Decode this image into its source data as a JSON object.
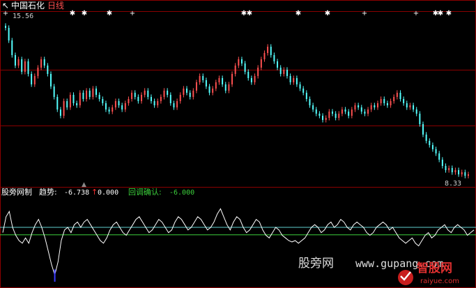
{
  "header": {
    "stock_name": "中国石化",
    "period": "日线",
    "high_label": "15.56",
    "low_label": "8.33"
  },
  "indicator": {
    "name": "股旁网制",
    "trend_label": "趋势:",
    "trend_value": "-6.738",
    "trend_arrow": "↑",
    "second_value": "0.000",
    "confirm_label": "回调确认:",
    "confirm_value": "-6.000"
  },
  "watermark": {
    "site_cn": "股旁网",
    "site_url": "www.gupang.com",
    "brand": "智股网",
    "brand_url": "raiyue.com"
  },
  "colors": {
    "background": "#000000",
    "frame": "#8b0000",
    "grid": "#8b0000",
    "up_candle": "#ff5050",
    "down_candle": "#54ffff",
    "indicator_line": "#ffffff",
    "upper_ref_line": "#5fd0d0",
    "lower_ref_line": "#3cd03c",
    "trend_text": "#ffffff",
    "confirm_text": "#3cd03c",
    "arrow": "#ff3030",
    "signal_blue": "#3a3aff",
    "marker": "#ffffff"
  },
  "chart_data": [
    {
      "type": "candlestick",
      "title": "中国石化 日线",
      "price_high": 15.56,
      "price_low": 8.33,
      "ylim": [
        8.0,
        16.0
      ],
      "grid": true,
      "closes": [
        15.4,
        14.8,
        14.1,
        13.6,
        13.9,
        13.3,
        13.8,
        13.2,
        12.7,
        13.1,
        13.5,
        13.9,
        13.6,
        13.2,
        12.6,
        12.1,
        11.5,
        11.2,
        11.9,
        11.6,
        12.2,
        11.8,
        11.7,
        12.3,
        12.0,
        12.4,
        12.1,
        12.5,
        12.2,
        12.0,
        11.8,
        11.5,
        11.4,
        11.6,
        11.9,
        11.7,
        11.5,
        11.8,
        12.0,
        12.3,
        12.1,
        11.9,
        12.2,
        12.4,
        12.1,
        11.9,
        11.7,
        11.9,
        12.1,
        12.4,
        12.2,
        11.8,
        11.6,
        11.9,
        12.2,
        12.5,
        12.3,
        12.1,
        12.4,
        12.8,
        13.1,
        12.9,
        12.6,
        12.3,
        12.5,
        12.8,
        13.0,
        12.7,
        12.4,
        12.7,
        13.2,
        13.6,
        13.9,
        13.7,
        13.3,
        13.0,
        12.8,
        13.1,
        13.5,
        13.9,
        14.2,
        14.5,
        14.1,
        13.8,
        13.5,
        13.2,
        13.4,
        13.1,
        12.8,
        13.0,
        12.7,
        12.5,
        12.3,
        12.0,
        11.7,
        11.5,
        11.3,
        11.2,
        11.0,
        11.1,
        11.4,
        11.3,
        11.1,
        11.3,
        11.5,
        11.4,
        11.2,
        11.5,
        11.7,
        11.6,
        11.4,
        11.3,
        11.5,
        11.7,
        11.6,
        11.8,
        12.0,
        11.8,
        11.7,
        11.9,
        12.1,
        12.3,
        12.0,
        11.8,
        11.6,
        11.7,
        11.5,
        11.3,
        10.8,
        10.3,
        10.0,
        9.8,
        9.6,
        9.4,
        9.1,
        8.8,
        8.6,
        8.7,
        8.5,
        8.6,
        8.4,
        8.5,
        8.33,
        8.4
      ]
    },
    {
      "type": "line",
      "title": "股旁网制",
      "series": [
        {
          "name": "趋势",
          "values": [
            -2,
            4,
            6,
            0,
            -3,
            -5,
            -6,
            -4,
            -6,
            -2,
            1,
            3,
            0,
            -4,
            -9,
            -14,
            -18,
            -13,
            -5,
            -1,
            0,
            -2,
            1,
            2,
            0,
            2,
            3,
            1,
            -1,
            -3,
            -5,
            -6,
            -4,
            -1,
            1,
            2,
            0,
            -2,
            -3,
            -1,
            1,
            3,
            4,
            2,
            0,
            -2,
            -1,
            1,
            3,
            2,
            0,
            -2,
            -1,
            2,
            4,
            3,
            1,
            -1,
            0,
            2,
            4,
            3,
            1,
            -1,
            0,
            2,
            5,
            7,
            4,
            1,
            -1,
            2,
            4,
            3,
            0,
            -2,
            -1,
            1,
            3,
            2,
            -1,
            -3,
            -4,
            -2,
            0,
            -1,
            -3,
            -4,
            -5,
            -5.5,
            -5,
            -6,
            -5,
            -4,
            -2,
            0,
            1,
            0,
            -2,
            -1,
            1,
            2,
            0,
            1,
            3,
            2,
            0,
            -1,
            1,
            2,
            1,
            0,
            -2,
            -3,
            -2,
            0,
            1,
            2,
            1,
            -1,
            0,
            -2,
            -4,
            -5,
            -6,
            -5,
            -4,
            -6,
            -7,
            -5,
            -3,
            -2,
            -4,
            -3,
            -1,
            0,
            1,
            -1,
            -2,
            0,
            1,
            0,
            -1,
            -3,
            -2,
            -1
          ]
        },
        {
          "name": "回调确认",
          "values": [
            -6.0
          ]
        }
      ],
      "legend": [
        "趋势: -6.738↑, 0.000",
        "回调确认: -6.000"
      ]
    }
  ]
}
